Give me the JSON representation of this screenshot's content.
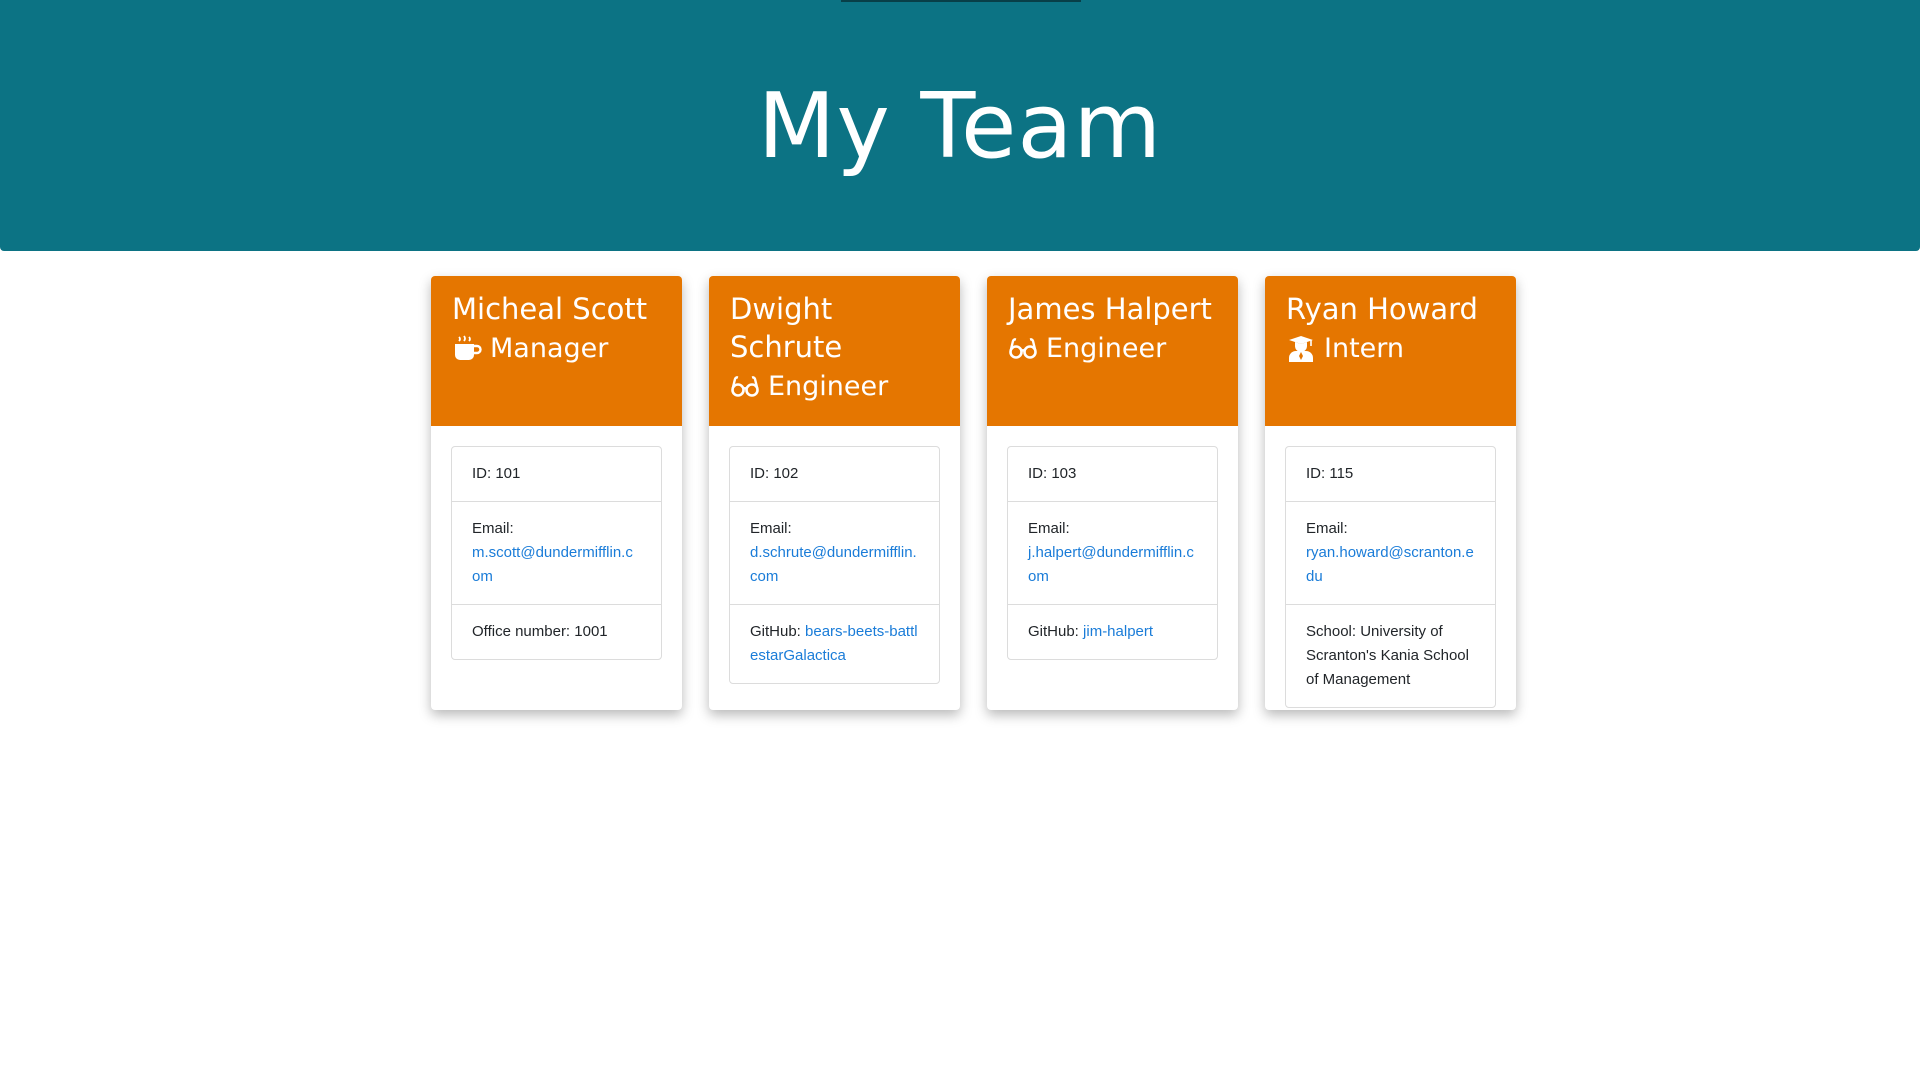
{
  "header": {
    "title": "My Team"
  },
  "colors": {
    "header_bg": "#0c7384",
    "card_header_bg": "#e57600",
    "link": "#1a7cd8"
  },
  "cards": [
    {
      "name": "Micheal Scott",
      "role": "Manager",
      "role_icon": "coffee-icon",
      "id": "ID: 101",
      "email_label": "Email:",
      "email": "m.scott@dundermifflin.com",
      "extra_label": "Office number: 1001",
      "extra_value": ""
    },
    {
      "name": "Dwight Schrute",
      "role": "Engineer",
      "role_icon": "glasses-icon",
      "id": "ID: 102",
      "email_label": "Email:",
      "email": "d.schrute@dundermifflin.com",
      "extra_label": "GitHub: ",
      "extra_value": "bears-beets-battlestarGalactica"
    },
    {
      "name": "James Halpert",
      "role": "Engineer",
      "role_icon": "glasses-icon",
      "id": "ID: 103",
      "email_label": "Email:",
      "email": "j.halpert@dundermifflin.com",
      "extra_label": "GitHub: ",
      "extra_value": "jim-halpert"
    },
    {
      "name": "Ryan Howard",
      "role": "Intern",
      "role_icon": "graduate-icon",
      "id": "ID: 115",
      "email_label": "Email:",
      "email": "ryan.howard@scranton.edu",
      "extra_label": "School: University of Scranton's Kania School of Management",
      "extra_value": ""
    }
  ]
}
